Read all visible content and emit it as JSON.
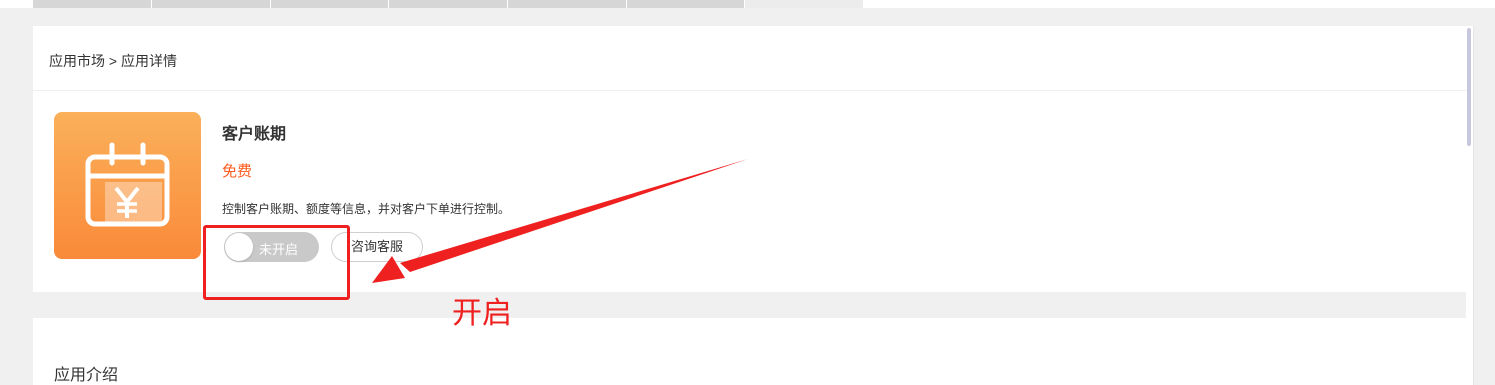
{
  "breadcrumb": {
    "text": "应用市场 > 应用详情"
  },
  "app": {
    "name": "客户账期",
    "price": "免费",
    "description": "控制客户账期、额度等信息，并对客户下单进行控制。",
    "icon": "calendar-yen-icon",
    "toggle": {
      "label": "未开启",
      "enabled": false
    },
    "consult_label": "咨询客服"
  },
  "section": {
    "title": "应用介绍"
  },
  "annotation": {
    "label": "开启",
    "color": "#ef2020"
  },
  "colors": {
    "accent": "#ff5a1f",
    "icon_bg_top": "#fbb05a",
    "icon_bg_bottom": "#f98a3a",
    "toggle_off": "#c9c9c9"
  }
}
